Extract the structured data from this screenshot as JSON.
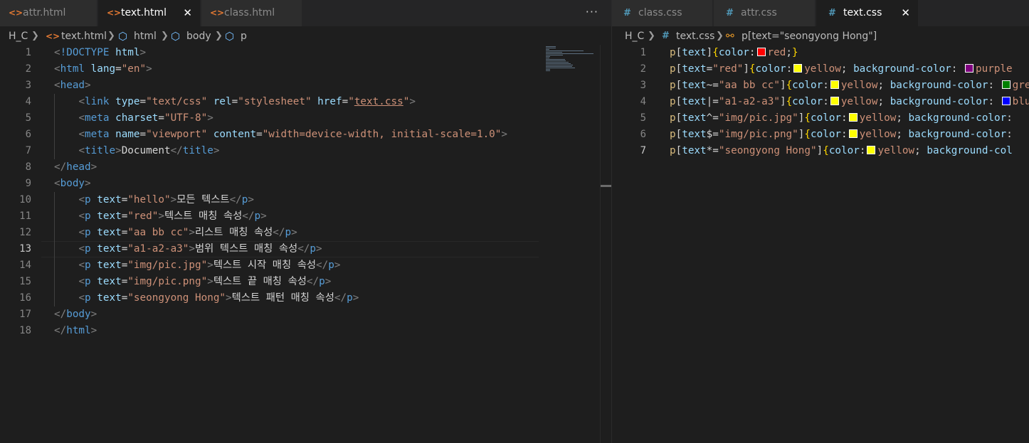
{
  "left_pane": {
    "tabs": [
      {
        "label": "attr.html",
        "icon": "html-file-icon",
        "active": false
      },
      {
        "label": "text.html",
        "icon": "html-file-icon",
        "active": true
      },
      {
        "label": "class.html",
        "icon": "html-file-icon",
        "active": false
      }
    ],
    "more_actions": "···",
    "breadcrumb": [
      "H_C",
      "text.html",
      "html",
      "body",
      "p"
    ],
    "current_line": 13
  },
  "right_pane": {
    "tabs": [
      {
        "label": "class.css",
        "icon": "css-file-icon",
        "active": false
      },
      {
        "label": "attr.css",
        "icon": "css-file-icon",
        "active": false
      },
      {
        "label": "text.css",
        "icon": "css-file-icon",
        "active": true
      }
    ],
    "breadcrumb": [
      "H_C",
      "text.css",
      "p[text=\"seongyong Hong\"]"
    ],
    "current_line": 7
  },
  "swatch_colors": {
    "red": "#ff0000",
    "yellow": "#ffff00",
    "purple": "#800080",
    "green": "#008000",
    "blue": "#0000ff"
  },
  "html_lines": [
    [
      [
        "punc",
        "<"
      ],
      [
        "tag",
        "!DOCTYPE"
      ],
      [
        "text",
        " "
      ],
      [
        "attr",
        "html"
      ],
      [
        "punc",
        ">"
      ]
    ],
    [
      [
        "punc",
        "<"
      ],
      [
        "tag",
        "html"
      ],
      [
        "text",
        " "
      ],
      [
        "attr",
        "lang"
      ],
      [
        "text",
        "="
      ],
      [
        "str",
        "\"en\""
      ],
      [
        "punc",
        ">"
      ]
    ],
    [
      [
        "punc",
        "<"
      ],
      [
        "tag",
        "head"
      ],
      [
        "punc",
        ">"
      ]
    ],
    [
      [
        "text",
        "    "
      ],
      [
        "punc",
        "<"
      ],
      [
        "tag",
        "link"
      ],
      [
        "text",
        " "
      ],
      [
        "attr",
        "type"
      ],
      [
        "text",
        "="
      ],
      [
        "str",
        "\"text/css\""
      ],
      [
        "text",
        " "
      ],
      [
        "attr",
        "rel"
      ],
      [
        "text",
        "="
      ],
      [
        "str",
        "\"stylesheet\""
      ],
      [
        "text",
        " "
      ],
      [
        "attr",
        "href"
      ],
      [
        "text",
        "="
      ],
      [
        "str",
        "\""
      ],
      [
        "link",
        "text.css"
      ],
      [
        "str",
        "\""
      ],
      [
        "punc",
        ">"
      ]
    ],
    [
      [
        "text",
        "    "
      ],
      [
        "punc",
        "<"
      ],
      [
        "tag",
        "meta"
      ],
      [
        "text",
        " "
      ],
      [
        "attr",
        "charset"
      ],
      [
        "text",
        "="
      ],
      [
        "str",
        "\"UTF-8\""
      ],
      [
        "punc",
        ">"
      ]
    ],
    [
      [
        "text",
        "    "
      ],
      [
        "punc",
        "<"
      ],
      [
        "tag",
        "meta"
      ],
      [
        "text",
        " "
      ],
      [
        "attr",
        "name"
      ],
      [
        "text",
        "="
      ],
      [
        "str",
        "\"viewport\""
      ],
      [
        "text",
        " "
      ],
      [
        "attr",
        "content"
      ],
      [
        "text",
        "="
      ],
      [
        "str",
        "\"width=device-width, initial-scale=1.0\""
      ],
      [
        "punc",
        ">"
      ]
    ],
    [
      [
        "text",
        "    "
      ],
      [
        "punc",
        "<"
      ],
      [
        "tag",
        "title"
      ],
      [
        "punc",
        ">"
      ],
      [
        "text",
        "Document"
      ],
      [
        "punc",
        "</"
      ],
      [
        "tag",
        "title"
      ],
      [
        "punc",
        ">"
      ]
    ],
    [
      [
        "punc",
        "</"
      ],
      [
        "tag",
        "head"
      ],
      [
        "punc",
        ">"
      ]
    ],
    [
      [
        "punc",
        "<"
      ],
      [
        "tag",
        "body"
      ],
      [
        "punc",
        ">"
      ]
    ],
    [
      [
        "text",
        "    "
      ],
      [
        "punc",
        "<"
      ],
      [
        "tag",
        "p"
      ],
      [
        "text",
        " "
      ],
      [
        "attr",
        "text"
      ],
      [
        "text",
        "="
      ],
      [
        "str",
        "\"hello\""
      ],
      [
        "punc",
        ">"
      ],
      [
        "text",
        "모든 텍스트"
      ],
      [
        "punc",
        "</"
      ],
      [
        "tag",
        "p"
      ],
      [
        "punc",
        ">"
      ]
    ],
    [
      [
        "text",
        "    "
      ],
      [
        "punc",
        "<"
      ],
      [
        "tag",
        "p"
      ],
      [
        "text",
        " "
      ],
      [
        "attr",
        "text"
      ],
      [
        "text",
        "="
      ],
      [
        "str",
        "\"red\""
      ],
      [
        "punc",
        ">"
      ],
      [
        "text",
        "텍스트 매칭 속성"
      ],
      [
        "punc",
        "</"
      ],
      [
        "tag",
        "p"
      ],
      [
        "punc",
        ">"
      ]
    ],
    [
      [
        "text",
        "    "
      ],
      [
        "punc",
        "<"
      ],
      [
        "tag",
        "p"
      ],
      [
        "text",
        " "
      ],
      [
        "attr",
        "text"
      ],
      [
        "text",
        "="
      ],
      [
        "str",
        "\"aa bb cc\""
      ],
      [
        "punc",
        ">"
      ],
      [
        "text",
        "리스트 매칭 속성"
      ],
      [
        "punc",
        "</"
      ],
      [
        "tag",
        "p"
      ],
      [
        "punc",
        ">"
      ]
    ],
    [
      [
        "text",
        "    "
      ],
      [
        "punc",
        "<"
      ],
      [
        "tag",
        "p"
      ],
      [
        "text",
        " "
      ],
      [
        "attr",
        "text"
      ],
      [
        "text",
        "="
      ],
      [
        "str",
        "\"a1-a2-a3\""
      ],
      [
        "punc",
        ">"
      ],
      [
        "text",
        "범위 텍스트 매칭 속성"
      ],
      [
        "punc",
        "</"
      ],
      [
        "tag",
        "p"
      ],
      [
        "punc",
        ">"
      ]
    ],
    [
      [
        "text",
        "    "
      ],
      [
        "punc",
        "<"
      ],
      [
        "tag",
        "p"
      ],
      [
        "text",
        " "
      ],
      [
        "attr",
        "text"
      ],
      [
        "text",
        "="
      ],
      [
        "str",
        "\"img/pic.jpg\""
      ],
      [
        "punc",
        ">"
      ],
      [
        "text",
        "텍스트 시작 매칭 속성"
      ],
      [
        "punc",
        "</"
      ],
      [
        "tag",
        "p"
      ],
      [
        "punc",
        ">"
      ]
    ],
    [
      [
        "text",
        "    "
      ],
      [
        "punc",
        "<"
      ],
      [
        "tag",
        "p"
      ],
      [
        "text",
        " "
      ],
      [
        "attr",
        "text"
      ],
      [
        "text",
        "="
      ],
      [
        "str",
        "\"img/pic.png\""
      ],
      [
        "punc",
        ">"
      ],
      [
        "text",
        "텍스트 끝 매칭 속성"
      ],
      [
        "punc",
        "</"
      ],
      [
        "tag",
        "p"
      ],
      [
        "punc",
        ">"
      ]
    ],
    [
      [
        "text",
        "    "
      ],
      [
        "punc",
        "<"
      ],
      [
        "tag",
        "p"
      ],
      [
        "text",
        " "
      ],
      [
        "attr",
        "text"
      ],
      [
        "text",
        "="
      ],
      [
        "str",
        "\"seongyong Hong\""
      ],
      [
        "punc",
        ">"
      ],
      [
        "text",
        "텍스트 패턴 매칭 속성"
      ],
      [
        "punc",
        "</"
      ],
      [
        "tag",
        "p"
      ],
      [
        "punc",
        ">"
      ]
    ],
    [
      [
        "punc",
        "</"
      ],
      [
        "tag",
        "body"
      ],
      [
        "punc",
        ">"
      ]
    ],
    [
      [
        "punc",
        "</"
      ],
      [
        "tag",
        "html"
      ],
      [
        "punc",
        ">"
      ]
    ]
  ],
  "css_lines": [
    [
      [
        "sel",
        "p"
      ],
      [
        "plain",
        "["
      ],
      [
        "prop",
        "text"
      ],
      [
        "plain",
        "]"
      ],
      [
        "brace",
        "{"
      ],
      [
        "prop",
        "color"
      ],
      [
        "plain",
        ":"
      ],
      [
        "swatch",
        "red"
      ],
      [
        "val",
        "red"
      ],
      [
        "plain",
        ";"
      ],
      [
        "brace",
        "}"
      ]
    ],
    [
      [
        "sel",
        "p"
      ],
      [
        "plain",
        "["
      ],
      [
        "prop",
        "text"
      ],
      [
        "plain",
        "="
      ],
      [
        "val",
        "\"red\""
      ],
      [
        "plain",
        "]"
      ],
      [
        "brace",
        "{"
      ],
      [
        "prop",
        "color"
      ],
      [
        "plain",
        ":"
      ],
      [
        "swatch",
        "yellow"
      ],
      [
        "val",
        "yellow"
      ],
      [
        "plain",
        "; "
      ],
      [
        "prop",
        "background-color"
      ],
      [
        "plain",
        ": "
      ],
      [
        "swatch",
        "purple"
      ],
      [
        "val",
        "purple"
      ]
    ],
    [
      [
        "sel",
        "p"
      ],
      [
        "plain",
        "["
      ],
      [
        "prop",
        "text"
      ],
      [
        "plain",
        "~="
      ],
      [
        "val",
        "\"aa bb cc\""
      ],
      [
        "plain",
        "]"
      ],
      [
        "brace",
        "{"
      ],
      [
        "prop",
        "color"
      ],
      [
        "plain",
        ":"
      ],
      [
        "swatch",
        "yellow"
      ],
      [
        "val",
        "yellow"
      ],
      [
        "plain",
        "; "
      ],
      [
        "prop",
        "background-color"
      ],
      [
        "plain",
        ": "
      ],
      [
        "swatch",
        "green"
      ],
      [
        "val",
        "green"
      ]
    ],
    [
      [
        "sel",
        "p"
      ],
      [
        "plain",
        "["
      ],
      [
        "prop",
        "text"
      ],
      [
        "plain",
        "|="
      ],
      [
        "val",
        "\"a1-a2-a3\""
      ],
      [
        "plain",
        "]"
      ],
      [
        "brace",
        "{"
      ],
      [
        "prop",
        "color"
      ],
      [
        "plain",
        ":"
      ],
      [
        "swatch",
        "yellow"
      ],
      [
        "val",
        "yellow"
      ],
      [
        "plain",
        "; "
      ],
      [
        "prop",
        "background-color"
      ],
      [
        "plain",
        ": "
      ],
      [
        "swatch",
        "blue"
      ],
      [
        "val",
        "blue"
      ]
    ],
    [
      [
        "sel",
        "p"
      ],
      [
        "plain",
        "["
      ],
      [
        "prop",
        "text"
      ],
      [
        "plain",
        "^="
      ],
      [
        "val",
        "\"img/pic.jpg\""
      ],
      [
        "plain",
        "]"
      ],
      [
        "brace",
        "{"
      ],
      [
        "prop",
        "color"
      ],
      [
        "plain",
        ":"
      ],
      [
        "swatch",
        "yellow"
      ],
      [
        "val",
        "yellow"
      ],
      [
        "plain",
        "; "
      ],
      [
        "prop",
        "background-color"
      ],
      [
        "plain",
        ":"
      ]
    ],
    [
      [
        "sel",
        "p"
      ],
      [
        "plain",
        "["
      ],
      [
        "prop",
        "text"
      ],
      [
        "plain",
        "$="
      ],
      [
        "val",
        "\"img/pic.png\""
      ],
      [
        "plain",
        "]"
      ],
      [
        "brace",
        "{"
      ],
      [
        "prop",
        "color"
      ],
      [
        "plain",
        ":"
      ],
      [
        "swatch",
        "yellow"
      ],
      [
        "val",
        "yellow"
      ],
      [
        "plain",
        "; "
      ],
      [
        "prop",
        "background-color"
      ],
      [
        "plain",
        ":"
      ]
    ],
    [
      [
        "sel",
        "p"
      ],
      [
        "plain",
        "["
      ],
      [
        "prop",
        "text"
      ],
      [
        "plain",
        "*="
      ],
      [
        "val",
        "\"seongyong Hong\""
      ],
      [
        "plain",
        "]"
      ],
      [
        "brace",
        "{"
      ],
      [
        "prop",
        "color"
      ],
      [
        "plain",
        ":"
      ],
      [
        "swatch",
        "yellow"
      ],
      [
        "val",
        "yellow"
      ],
      [
        "plain",
        "; "
      ],
      [
        "prop",
        "background-col"
      ]
    ]
  ]
}
